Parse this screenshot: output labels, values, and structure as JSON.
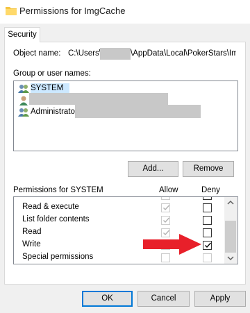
{
  "window": {
    "title": "Permissions for ImgCache",
    "icons": [
      "folder-icon"
    ]
  },
  "tabs": [
    {
      "label": "Security",
      "selected": true
    }
  ],
  "object": {
    "label": "Object name:",
    "path_prefix": "C:\\Users\\",
    "path_suffix": "\\AppData\\Local\\PokerStars\\Img"
  },
  "groups": {
    "label": "Group or user names:",
    "items": [
      {
        "name": "SYSTEM",
        "icon": "users-icon",
        "selected": true
      },
      {
        "name": "",
        "icon": "user-icon",
        "selected": false
      },
      {
        "name": "Administrators",
        "icon": "users-icon",
        "selected": false
      }
    ]
  },
  "buttons": {
    "add": "Add...",
    "remove": "Remove",
    "ok": "OK",
    "cancel": "Cancel",
    "apply": "Apply"
  },
  "permissions": {
    "label": "Permissions for SYSTEM",
    "allow_label": "Allow",
    "deny_label": "Deny",
    "rows": [
      {
        "name": "Read & execute",
        "allow": true,
        "allow_disabled": true,
        "deny": false,
        "deny_disabled": false
      },
      {
        "name": "List folder contents",
        "allow": true,
        "allow_disabled": true,
        "deny": false,
        "deny_disabled": false
      },
      {
        "name": "Read",
        "allow": true,
        "allow_disabled": true,
        "deny": false,
        "deny_disabled": false
      },
      {
        "name": "Write",
        "allow": true,
        "allow_disabled": true,
        "deny": true,
        "deny_disabled": false
      },
      {
        "name": "Special permissions",
        "allow": false,
        "allow_disabled": true,
        "deny": false,
        "deny_disabled": true
      }
    ]
  },
  "colors": {
    "accent": "#0078d7",
    "selection": "#cce8ff",
    "annotation_arrow": "#e8202a"
  }
}
